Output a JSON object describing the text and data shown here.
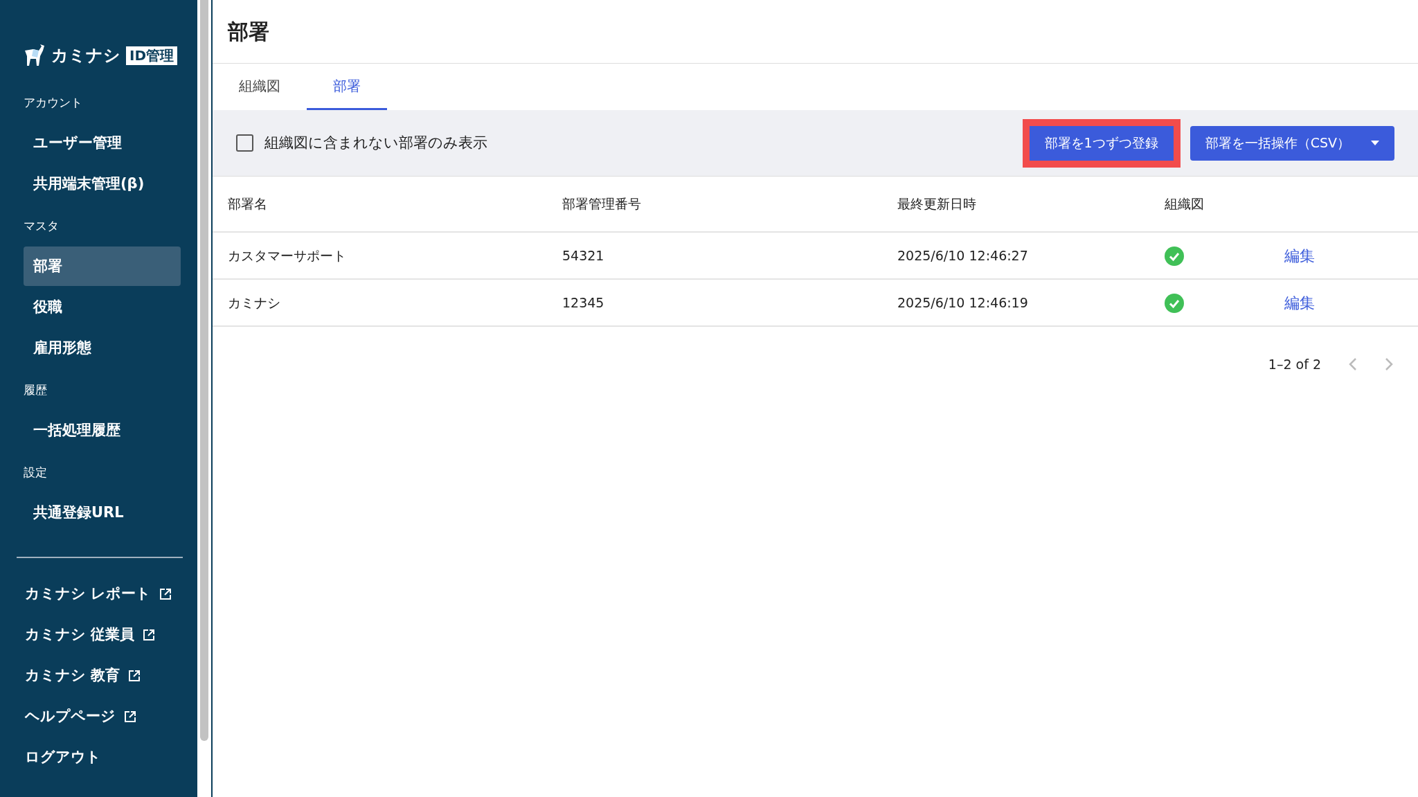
{
  "sidebar": {
    "logo": {
      "name": "カミナシ",
      "badge": "ID管理"
    },
    "sections": [
      {
        "label": "アカウント",
        "items": [
          {
            "label": "ユーザー管理",
            "selected": false
          },
          {
            "label": "共用端末管理(β)",
            "selected": false
          }
        ]
      },
      {
        "label": "マスタ",
        "items": [
          {
            "label": "部署",
            "selected": true
          },
          {
            "label": "役職",
            "selected": false
          },
          {
            "label": "雇用形態",
            "selected": false
          }
        ]
      },
      {
        "label": "履歴",
        "items": [
          {
            "label": "一括処理履歴",
            "selected": false
          }
        ]
      },
      {
        "label": "設定",
        "items": [
          {
            "label": "共通登録URL",
            "selected": false
          }
        ]
      }
    ],
    "links": [
      {
        "label": "カミナシ レポート",
        "external": true
      },
      {
        "label": "カミナシ 従業員",
        "external": true
      },
      {
        "label": "カミナシ 教育",
        "external": true
      },
      {
        "label": "ヘルプページ",
        "external": true
      },
      {
        "label": "ログアウト",
        "external": false
      }
    ]
  },
  "page_title": "部署",
  "tabs": [
    {
      "label": "組織図",
      "selected": false
    },
    {
      "label": "部署",
      "selected": true
    }
  ],
  "toolbar": {
    "filter": {
      "label": "組織図に含まれない部署のみ表示",
      "checked": false
    },
    "buttons": [
      {
        "label": "部署を1つずつ登録",
        "kind": "plain",
        "highlighted": true
      },
      {
        "label": "部署を一括操作（CSV）",
        "kind": "dropdown",
        "highlighted": false
      }
    ]
  },
  "table": {
    "columns": [
      "部署名",
      "部署管理番号",
      "最終更新日時",
      "組織図"
    ],
    "rows": [
      {
        "name": "カスタマーサポート",
        "number": "54321",
        "updated": "2025/6/10 12:46:27",
        "in_chart": true,
        "action": "編集"
      },
      {
        "name": "カミナシ",
        "number": "12345",
        "updated": "2025/6/10 12:46:19",
        "in_chart": true,
        "action": "編集"
      }
    ]
  },
  "pagination": {
    "range": "1–2 of 2"
  }
}
